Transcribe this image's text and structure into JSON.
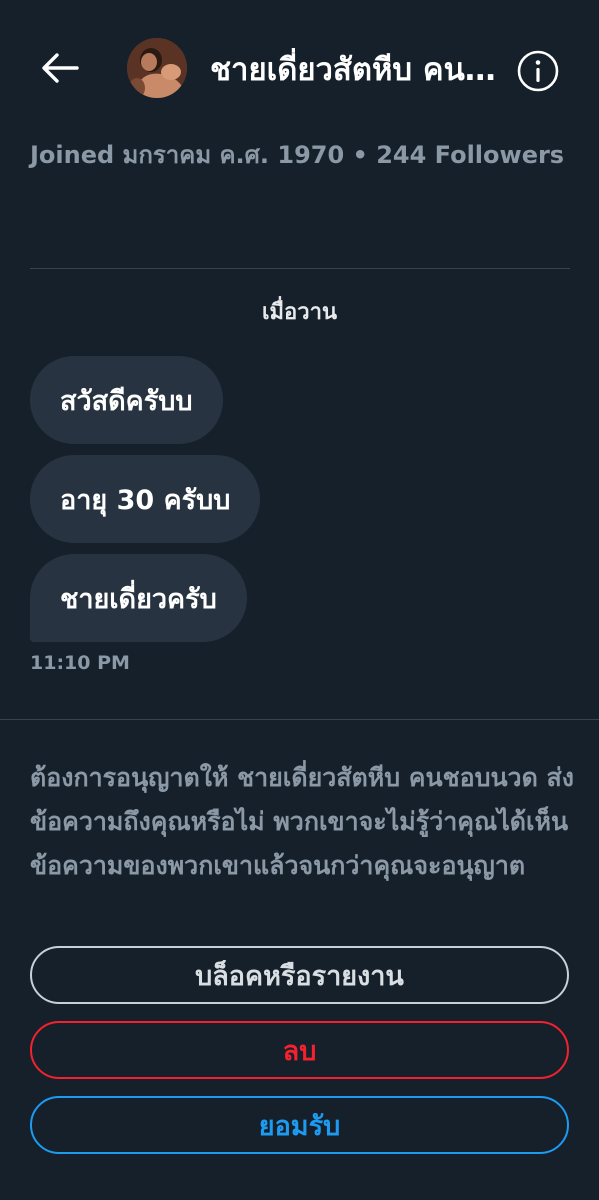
{
  "header": {
    "title": "ชายเดี่ยวสัตหีบ คนชอบนวด",
    "back_icon": "arrow-left-icon",
    "info_icon": "info-circle-icon"
  },
  "profile": {
    "meta": "Joined มกราคม ค.ศ. 1970 • 244 Followers"
  },
  "conversation": {
    "date_label": "เมื่อวาน",
    "messages": [
      {
        "text": "สวัสดีครับบ"
      },
      {
        "text": "อายุ 30 ครับบ"
      },
      {
        "text": "ชายเดี่ยวครับ"
      }
    ],
    "timestamp": "11:10 PM"
  },
  "request": {
    "notice": "ต้องการอนุญาตให้ ชายเดี่ยวสัตหีบ คนชอบนวด ส่งข้อความถึงคุณหรือไม่ พวกเขาจะไม่รู้ว่าคุณได้เห็นข้อความของพวกเขาแล้วจนกว่าคุณจะอนุญาต",
    "block_label": "บล็อคหรือรายงาน",
    "delete_label": "ลบ",
    "accept_label": "ยอมรับ"
  },
  "colors": {
    "background": "#15202b",
    "bubble": "#273340",
    "muted_text": "#8b98a5",
    "delete_red": "#f4212e",
    "accept_blue": "#1d9bf0"
  }
}
